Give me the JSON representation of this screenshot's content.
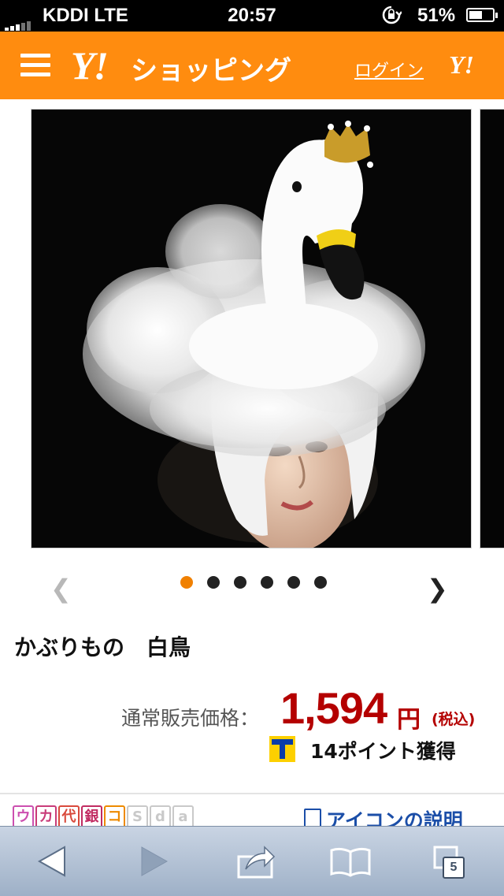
{
  "status_bar": {
    "carrier": "KDDI  LTE",
    "time": "20:57",
    "battery": "51%"
  },
  "header": {
    "logo_mark": "Y!",
    "logo_text": "ショッピング",
    "login_label": "ログイン",
    "corner_logo": "Y!"
  },
  "gallery": {
    "image_count": 6,
    "current_index": 1
  },
  "product": {
    "title": "かぶりもの　白鳥",
    "price_label": "通常販売価格：",
    "price": "1,594",
    "yen": "円",
    "tax_note": "(税込)",
    "points": "14ポイント獲得"
  },
  "icon_strip": {
    "icons": [
      {
        "label": "ウ",
        "color": "#cc4fb0"
      },
      {
        "label": "カ",
        "color": "#c93c79"
      },
      {
        "label": "代",
        "color": "#d94a3c"
      },
      {
        "label": "銀",
        "color": "#c12c62"
      },
      {
        "label": "コ",
        "color": "#ee8a00"
      },
      {
        "label": "S",
        "color": "#c9c9c9"
      },
      {
        "label": "d",
        "color": "#c9c9c9"
      },
      {
        "label": "a",
        "color": "#c9c9c9"
      }
    ],
    "help_label": "アイコンの説明"
  },
  "toolbar": {
    "tabs_count": "5"
  },
  "colors": {
    "brand": "#ff8c0f",
    "price": "#b40000",
    "active_dot": "#f08000",
    "link": "#1b4ea8"
  }
}
